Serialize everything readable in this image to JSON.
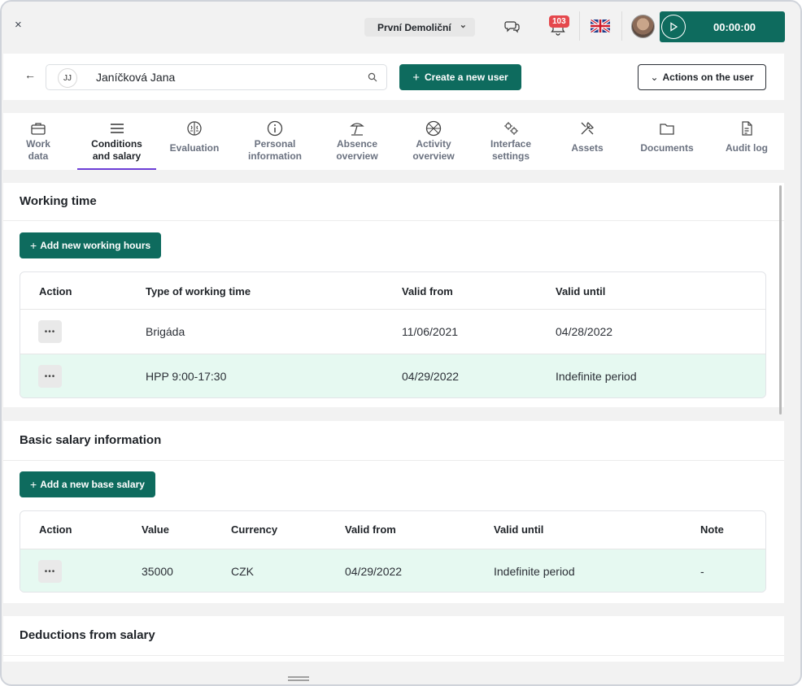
{
  "topbar": {
    "close_label": "×",
    "company": "První Demoliční",
    "notifications_count": "103",
    "timer": "00:00:00"
  },
  "user": {
    "initials": "JJ",
    "name": "Janíčková Jana",
    "create_button": "Create a new user",
    "actions_button": "Actions on the user"
  },
  "tabs": [
    {
      "l1": "Work",
      "l2": "data",
      "icon": "briefcase-icon"
    },
    {
      "l1": "Conditions",
      "l2": "and salary",
      "icon": "menu-icon",
      "active": true
    },
    {
      "l1": "Evaluation",
      "l2": "",
      "icon": "brain-icon"
    },
    {
      "l1": "Personal",
      "l2": "information",
      "icon": "info-icon"
    },
    {
      "l1": "Absence",
      "l2": "overview",
      "icon": "beach-icon"
    },
    {
      "l1": "Activity",
      "l2": "overview",
      "icon": "ball-icon"
    },
    {
      "l1": "Interface",
      "l2": "settings",
      "icon": "cogs-icon"
    },
    {
      "l1": "Assets",
      "l2": "",
      "icon": "tools-icon"
    },
    {
      "l1": "Documents",
      "l2": "",
      "icon": "folder-icon"
    },
    {
      "l1": "Audit log",
      "l2": "",
      "icon": "document-icon"
    }
  ],
  "working_time": {
    "title": "Working time",
    "add_button": "Add new working hours",
    "headers": [
      "Action",
      "Type of working time",
      "Valid from",
      "Valid until"
    ],
    "rows": [
      {
        "type": "Brigáda",
        "from": "11/06/2021",
        "until": "04/28/2022"
      },
      {
        "type": "HPP 9:00-17:30",
        "from": "04/29/2022",
        "until": "Indefinite period"
      }
    ]
  },
  "salary": {
    "title": "Basic salary information",
    "add_button": "Add a new base salary",
    "headers": [
      "Action",
      "Value",
      "Currency",
      "Valid from",
      "Valid until",
      "Note"
    ],
    "rows": [
      {
        "value": "35000",
        "currency": "CZK",
        "from": "04/29/2022",
        "until": "Indefinite period",
        "note": "-"
      }
    ]
  },
  "deductions": {
    "title": "Deductions from salary"
  }
}
